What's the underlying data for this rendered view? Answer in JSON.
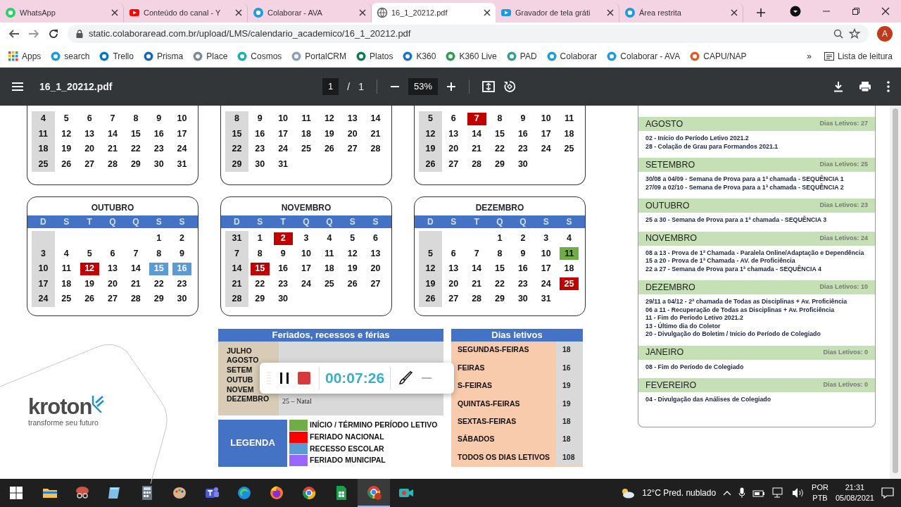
{
  "browser": {
    "tabs": [
      {
        "title": "WhatsApp",
        "selected": false
      },
      {
        "title": "Conteúdo do canal - Y",
        "selected": false
      },
      {
        "title": "Colaborar - AVA",
        "selected": false
      },
      {
        "title": "16_1_20212.pdf",
        "selected": true
      },
      {
        "title": "Gravador de tela gráti",
        "selected": false
      },
      {
        "title": "Área restrita",
        "selected": false
      }
    ],
    "url": "static.colaboraread.com.br/upload/LMS/calendario_academico/16_1_20212.pdf",
    "profile_initial": "A",
    "bookmarks": [
      "Apps",
      "search",
      "Trello",
      "Prisma",
      "Place",
      "Cosmos",
      "PortalCRM",
      "Platos",
      "K360",
      "K360 Live",
      "PAD",
      "Colaborar",
      "Colaborar - AVA",
      "CAPU/NAP"
    ],
    "more_bookmarks": "»",
    "reading_list": "Lista de leitura"
  },
  "pdf_toolbar": {
    "file_name": "16_1_20212.pdf",
    "page": "1",
    "page_separator": "/",
    "page_count": "1",
    "zoom": "53%"
  },
  "calendars_top": [
    {
      "weeks": [
        [
          {
            "d": "4"
          },
          {
            "d": "5"
          },
          {
            "d": "6"
          },
          {
            "d": "7"
          },
          {
            "d": "8"
          },
          {
            "d": "9"
          },
          {
            "d": "10"
          }
        ],
        [
          {
            "d": "11"
          },
          {
            "d": "12"
          },
          {
            "d": "13"
          },
          {
            "d": "14"
          },
          {
            "d": "15"
          },
          {
            "d": "16"
          },
          {
            "d": "17"
          }
        ],
        [
          {
            "d": "18"
          },
          {
            "d": "19"
          },
          {
            "d": "20"
          },
          {
            "d": "21"
          },
          {
            "d": "22"
          },
          {
            "d": "23"
          },
          {
            "d": "24"
          }
        ],
        [
          {
            "d": "25"
          },
          {
            "d": "26"
          },
          {
            "d": "27"
          },
          {
            "d": "28"
          },
          {
            "d": "29"
          },
          {
            "d": "30"
          },
          {
            "d": "31"
          }
        ]
      ]
    },
    {
      "weeks": [
        [
          {
            "d": "8"
          },
          {
            "d": "9"
          },
          {
            "d": "10"
          },
          {
            "d": "11"
          },
          {
            "d": "12"
          },
          {
            "d": "13"
          },
          {
            "d": "14"
          }
        ],
        [
          {
            "d": "15"
          },
          {
            "d": "16"
          },
          {
            "d": "17"
          },
          {
            "d": "18"
          },
          {
            "d": "19"
          },
          {
            "d": "20"
          },
          {
            "d": "21"
          }
        ],
        [
          {
            "d": "22"
          },
          {
            "d": "23"
          },
          {
            "d": "24"
          },
          {
            "d": "25"
          },
          {
            "d": "26"
          },
          {
            "d": "27"
          },
          {
            "d": "28"
          }
        ],
        [
          {
            "d": "29"
          },
          {
            "d": "30"
          },
          {
            "d": "31"
          }
        ]
      ]
    },
    {
      "weeks": [
        [
          {
            "d": "5"
          },
          {
            "d": "6"
          },
          {
            "d": "7",
            "color": "#c00000"
          },
          {
            "d": "8"
          },
          {
            "d": "9"
          },
          {
            "d": "10"
          },
          {
            "d": "11"
          }
        ],
        [
          {
            "d": "12"
          },
          {
            "d": "13"
          },
          {
            "d": "14"
          },
          {
            "d": "15"
          },
          {
            "d": "16"
          },
          {
            "d": "17"
          },
          {
            "d": "18"
          }
        ],
        [
          {
            "d": "19"
          },
          {
            "d": "20"
          },
          {
            "d": "21"
          },
          {
            "d": "22"
          },
          {
            "d": "23"
          },
          {
            "d": "24"
          },
          {
            "d": "25"
          }
        ],
        [
          {
            "d": "26"
          },
          {
            "d": "27"
          },
          {
            "d": "28"
          },
          {
            "d": "29"
          },
          {
            "d": "30"
          }
        ]
      ]
    }
  ],
  "calendars": [
    {
      "title": "OUTUBRO",
      "weekdays": [
        "D",
        "S",
        "T",
        "Q",
        "Q",
        "S",
        "S"
      ],
      "weeks": [
        [
          {
            "d": "1"
          },
          {
            "d": "2"
          }
        ],
        [
          {
            "d": "3"
          },
          {
            "d": "4"
          },
          {
            "d": "5"
          },
          {
            "d": "6"
          },
          {
            "d": "7"
          },
          {
            "d": "8"
          },
          {
            "d": "9"
          }
        ],
        [
          {
            "d": "10"
          },
          {
            "d": "11"
          },
          {
            "d": "12",
            "color": "#c00000"
          },
          {
            "d": "13"
          },
          {
            "d": "14"
          },
          {
            "d": "15",
            "color": "#5b9bd5"
          },
          {
            "d": "16",
            "color": "#5b9bd5"
          }
        ],
        [
          {
            "d": "17"
          },
          {
            "d": "18"
          },
          {
            "d": "19"
          },
          {
            "d": "20"
          },
          {
            "d": "21"
          },
          {
            "d": "22"
          },
          {
            "d": "23"
          }
        ],
        [
          {
            "d": "24"
          },
          {
            "d": "25"
          },
          {
            "d": "26"
          },
          {
            "d": "27"
          },
          {
            "d": "28"
          },
          {
            "d": "29"
          },
          {
            "d": "30"
          }
        ]
      ]
    },
    {
      "title": "NOVEMBRO",
      "weekdays": [
        "D",
        "S",
        "T",
        "Q",
        "Q",
        "S",
        "S"
      ],
      "weeks": [
        [
          {
            "d": "31"
          },
          {
            "d": "1"
          },
          {
            "d": "2",
            "color": "#c00000"
          },
          {
            "d": "3"
          },
          {
            "d": "4"
          },
          {
            "d": "5"
          },
          {
            "d": "6"
          }
        ],
        [
          {
            "d": "7"
          },
          {
            "d": "8"
          },
          {
            "d": "9"
          },
          {
            "d": "10"
          },
          {
            "d": "11"
          },
          {
            "d": "12"
          },
          {
            "d": "13"
          }
        ],
        [
          {
            "d": "14"
          },
          {
            "d": "15",
            "color": "#c00000"
          },
          {
            "d": "16"
          },
          {
            "d": "17"
          },
          {
            "d": "18"
          },
          {
            "d": "19"
          },
          {
            "d": "20"
          }
        ],
        [
          {
            "d": "21"
          },
          {
            "d": "22"
          },
          {
            "d": "23"
          },
          {
            "d": "24"
          },
          {
            "d": "25"
          },
          {
            "d": "26"
          },
          {
            "d": "27"
          }
        ],
        [
          {
            "d": "28"
          },
          {
            "d": "29"
          },
          {
            "d": "30"
          }
        ]
      ]
    },
    {
      "title": "DEZEMBRO",
      "weekdays": [
        "D",
        "S",
        "T",
        "Q",
        "Q",
        "S",
        "S"
      ],
      "weeks": [
        [
          {
            "d": "1"
          },
          {
            "d": "2"
          },
          {
            "d": "3"
          },
          {
            "d": "4"
          }
        ],
        [
          {
            "d": "5"
          },
          {
            "d": "6"
          },
          {
            "d": "7"
          },
          {
            "d": "8"
          },
          {
            "d": "9"
          },
          {
            "d": "10"
          },
          {
            "d": "11",
            "color": "#70ad47"
          }
        ],
        [
          {
            "d": "12"
          },
          {
            "d": "13"
          },
          {
            "d": "14"
          },
          {
            "d": "15"
          },
          {
            "d": "16"
          },
          {
            "d": "17"
          },
          {
            "d": "18"
          }
        ],
        [
          {
            "d": "19"
          },
          {
            "d": "20"
          },
          {
            "d": "21"
          },
          {
            "d": "22"
          },
          {
            "d": "23"
          },
          {
            "d": "24"
          },
          {
            "d": "25",
            "color": "#c00000"
          }
        ],
        [
          {
            "d": "26"
          },
          {
            "d": "27"
          },
          {
            "d": "28"
          },
          {
            "d": "29"
          },
          {
            "d": "30"
          },
          {
            "d": "31"
          }
        ]
      ]
    }
  ],
  "logo": {
    "name": "kroton",
    "tagline": "transforme seu futuro"
  },
  "holidays": {
    "title": "Feriados, recessos e férias",
    "rows": [
      {
        "month": "JULHO"
      },
      {
        "month": "AGOSTO"
      },
      {
        "month": "SETEM"
      },
      {
        "month": "OUTUB"
      },
      {
        "month": "NOVEM"
      },
      {
        "month": "DEZEMBRO",
        "detail": "25 – Natal"
      }
    ]
  },
  "legend": {
    "title": "LEGENDA",
    "items": [
      {
        "label": "INÍCIO / TÉRMINO PERÍODO LETIVO",
        "color": "#70ad47"
      },
      {
        "label": "FERIADO NACIONAL",
        "color": "#ff0000"
      },
      {
        "label": "RECESSO ESCOLAR",
        "color": "#5b9bd5"
      },
      {
        "label": "FERIADO MUNICIPAL",
        "color": "#9966ff"
      }
    ]
  },
  "school_days": {
    "title": "Dias letivos",
    "rows": [
      {
        "label": "SEGUNDAS-FEIRAS",
        "count": "18"
      },
      {
        "label": "FEIRAS",
        "count": "16"
      },
      {
        "label": "S-FEIRAS",
        "count": "19"
      },
      {
        "label": "QUINTAS-FEIRAS",
        "count": "19"
      },
      {
        "label": "SEXTAS-FEIRAS",
        "count": "18"
      },
      {
        "label": "SÁBADOS",
        "count": "18"
      },
      {
        "label": "TODOS OS DIAS LETIVOS",
        "count": "108"
      }
    ]
  },
  "events": [
    {
      "month": "AGOSTO",
      "days": "Dias Letivos: 27",
      "items": [
        "02 - Início do Período Letivo 2021.2",
        "28 - Colação de Grau para Formandos 2021.1"
      ]
    },
    {
      "month": "SETEMBRO",
      "days": "Dias Letivos: 25",
      "items": [
        "30/08 a 04/09 - Semana de Prova para a 1ª chamada - SEQUÊNCIA 1",
        "27/09 a 02/10 - Semana de Prova para a 1ª chamada - SEQUÊNCIA 2"
      ]
    },
    {
      "month": "OUTUBRO",
      "days": "Dias Letivos: 23",
      "items": [
        "25 a 30 - Semana de Prova para a 1ª chamada - SEQUÊNCIA 3"
      ]
    },
    {
      "month": "NOVEMBRO",
      "days": "Dias Letivos: 24",
      "items": [
        "08 a 13 - Prova de 1ª Chamada - Paralela Online/Adaptação e Dependência",
        "15 a 20 - Prova de 1ª Chamada - AV. de Proficiência",
        "22 a 27 - Semana de Prova para 1ª chamada - SEQUÊNCIA 4"
      ]
    },
    {
      "month": "DEZEMBRO",
      "days": "Dias Letivos: 10",
      "items": [
        "29/11 a 04/12 - 2ª chamada de Todas as Disciplinas + Av. Proficiência",
        "06 a 11 - Recuperação de Todas as Disciplinas + Av. Proficiência",
        "11 - Fim do Período Letivo 2021.2",
        "13 - Último dia do Coletor",
        "20 - Divulgação do Boletim / Início do Período de Colegiado"
      ]
    },
    {
      "month": "JANEIRO",
      "days": "Dias Letivos: 0",
      "items": [
        "08 - Fim do Período de Colegiado"
      ]
    },
    {
      "month": "FEVEREIRO",
      "days": "Dias Letivos: 0",
      "items": [
        "04 - Divulgação das Análises de Colegiado"
      ]
    }
  ],
  "recorder": {
    "time": "00:07:26"
  },
  "taskbar": {
    "apps": [
      {
        "selected": false
      },
      {
        "selected": false
      },
      {
        "selected": false
      },
      {
        "selected": false
      },
      {
        "selected": false
      },
      {
        "selected": false
      },
      {
        "selected": false
      },
      {
        "selected": false
      },
      {
        "selected": false
      },
      {
        "selected": false
      },
      {
        "selected": true
      },
      {
        "selected": false
      }
    ],
    "weather": "12°C Pred. nublado",
    "language": "POR",
    "layout": "PTB",
    "time": "21:31",
    "date": "05/08/2021"
  }
}
